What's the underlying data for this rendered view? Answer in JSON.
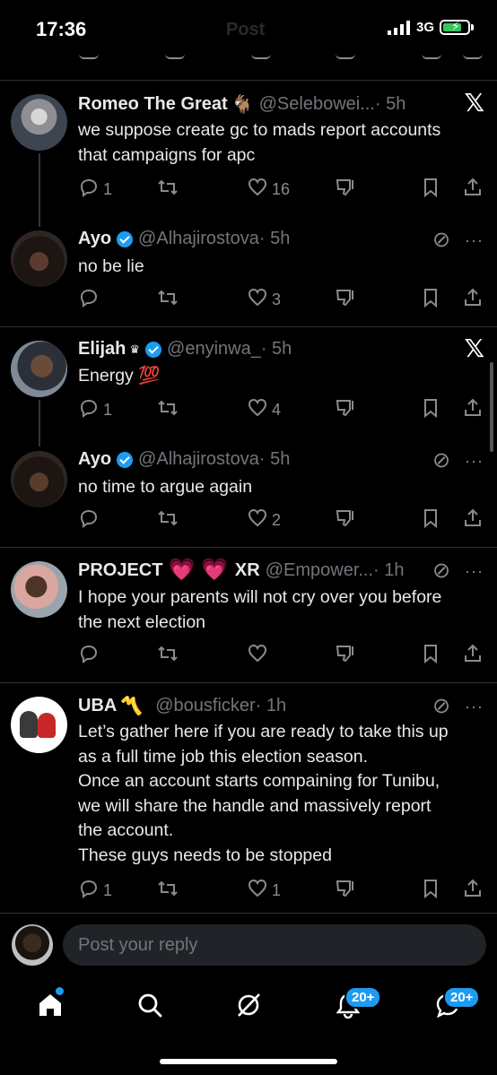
{
  "status_bar": {
    "time": "17:36",
    "network": "3G",
    "ghost_title": "Post"
  },
  "tweets": [
    {
      "name": "Romeo The Great",
      "emoji": "🐐",
      "handle": "@Selebowei...",
      "time": "· 5h",
      "lines": [
        "we suppose create gc to mads report accounts",
        "that campaigns for apc"
      ],
      "replies": "1",
      "retweets": "",
      "likes": "16"
    },
    {
      "name": "Ayo",
      "handle": "@Alhajirostova",
      "time": "· 5h",
      "lines": [
        "no be lie"
      ],
      "replies": "",
      "retweets": "",
      "likes": "3"
    },
    {
      "name": "Elijah",
      "crown": "♛",
      "handle": "@enyinwa_",
      "time": "· 5h",
      "lines": [
        "Energy 💯"
      ],
      "replies": "1",
      "retweets": "",
      "likes": "4"
    },
    {
      "name": "Ayo",
      "handle": "@Alhajirostova",
      "time": "· 5h",
      "lines": [
        "no time to argue again"
      ],
      "replies": "",
      "retweets": "",
      "likes": "2"
    },
    {
      "name": "PROJECT",
      "name_suffix": "XR",
      "hearts": "💗 💗",
      "handle": "@Empower...",
      "time": "· 1h",
      "lines": [
        "I hope your parents will not cry over you before",
        "the next election"
      ],
      "replies": "",
      "retweets": "",
      "likes": ""
    },
    {
      "name": "UBA",
      "emoji": "〽️",
      "handle": "@bousficker",
      "time": "· 1h",
      "lines": [
        "Let’s gather here if you are ready to take this up",
        "as a full time job this election season.",
        "Once an account starts compaining for Tunibu,",
        "we will share the handle and massively report",
        "the account.",
        "These guys needs to be stopped"
      ],
      "replies": "1",
      "retweets": "",
      "likes": "1"
    }
  ],
  "reply_bar": {
    "placeholder": "Post your reply"
  },
  "nav": {
    "notifications_badge": "20+",
    "messages_badge": "20+"
  },
  "colors": {
    "background": "#000000",
    "accent": "#1d9bf0",
    "text": "#e7e9ea",
    "muted": "#71767b"
  }
}
